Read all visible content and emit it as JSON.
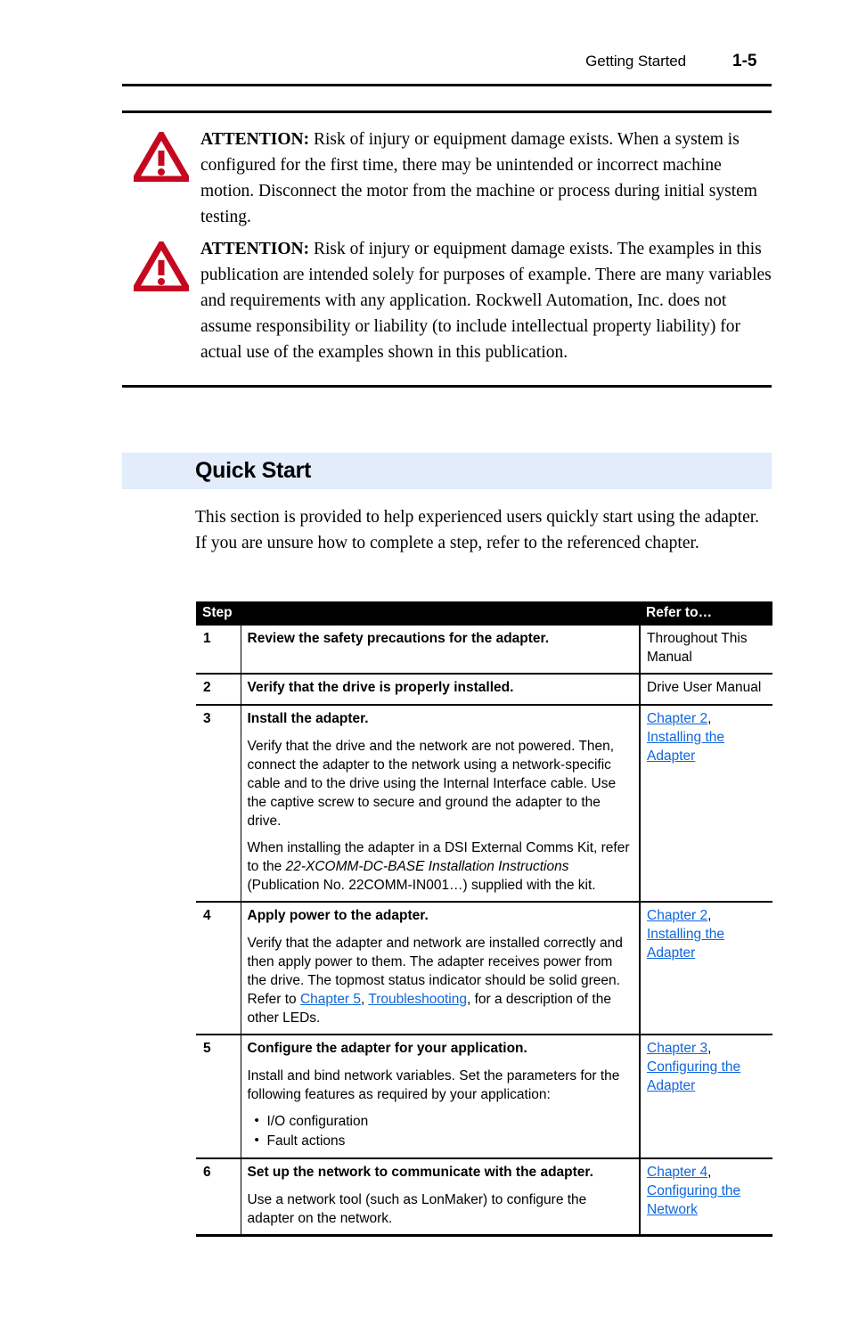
{
  "colors": {
    "link": "#1066dd",
    "band": "#e2ecfa",
    "warning": "#c5071f",
    "rule": "#000000",
    "header_bg": "#000000"
  },
  "running_header": {
    "title": "Getting Started",
    "page_number": "1-5"
  },
  "attentions": [
    {
      "icon": "warning-triangle-icon",
      "label": "ATTENTION:",
      "text": "Risk of injury or equipment damage exists. When a system is configured for the first time, there may be unintended or incorrect machine motion. Disconnect the motor from the machine or process during initial system testing."
    },
    {
      "icon": "warning-triangle-icon",
      "label": "ATTENTION:",
      "text": "Risk of injury or equipment damage exists. The examples in this publication are intended solely for purposes of example. There are many variables and requirements with any application. Rockwell Automation, Inc. does not assume responsibility or liability (to include intellectual property liability) for actual use of the examples shown in this publication."
    }
  ],
  "section": {
    "heading": "Quick Start",
    "intro": "This section is provided to help experienced users quickly start using the adapter. If you are unsure how to complete a step, refer to the referenced chapter."
  },
  "table": {
    "headers": {
      "step": "Step",
      "description": "",
      "refer_to": "Refer to…"
    },
    "rows": [
      {
        "step": "1",
        "title": "Review the safety precautions for the adapter.",
        "paragraphs": [],
        "bullets": [],
        "refer_plain": "Throughout This Manual"
      },
      {
        "step": "2",
        "title": "Verify that the drive is properly installed.",
        "paragraphs": [],
        "bullets": [],
        "refer_plain": "Drive User Manual"
      },
      {
        "step": "3",
        "title": "Install the adapter.",
        "paragraphs": [
          "Verify that the drive and the network are not powered. Then, connect the adapter to the network using a network-specific cable and to the drive using the Internal Interface cable. Use the captive screw to secure and ground the adapter to the drive."
        ],
        "para2_pre": "When installing the adapter in a DSI External Comms Kit, refer to the ",
        "para2_italic": "22-XCOMM-DC-BASE Installation Instructions",
        "para2_post": " (Publication No. 22COMM-IN001…) supplied with the kit.",
        "bullets": [],
        "refer_links": [
          "Chapter 2",
          "Installing the Adapter"
        ],
        "refer_sep": ","
      },
      {
        "step": "4",
        "title": "Apply power to the adapter.",
        "para_pre": "Verify that the adapter and network are installed correctly and then apply power to them. The adapter receives power from the drive. The topmost status indicator should be solid green. Refer to ",
        "para_link1": "Chapter 5",
        "para_mid": ", ",
        "para_link2": "Troubleshooting",
        "para_post": ", for a description of the other LEDs.",
        "bullets": [],
        "refer_links": [
          "Chapter 2",
          "Installing the Adapter"
        ],
        "refer_sep": ","
      },
      {
        "step": "5",
        "title": "Configure the adapter for your application.",
        "paragraphs": [
          "Install and bind network variables. Set the parameters for the following features as required by your application:"
        ],
        "bullets": [
          "I/O configuration",
          "Fault actions"
        ],
        "refer_links": [
          "Chapter 3",
          "Configuring the Adapter"
        ],
        "refer_sep": ","
      },
      {
        "step": "6",
        "title": "Set up the network to communicate with the adapter.",
        "paragraphs": [
          "Use a network tool (such as LonMaker) to configure the adapter on the network."
        ],
        "bullets": [],
        "refer_links": [
          "Chapter 4",
          "Configuring the Network"
        ],
        "refer_sep": ","
      }
    ]
  }
}
